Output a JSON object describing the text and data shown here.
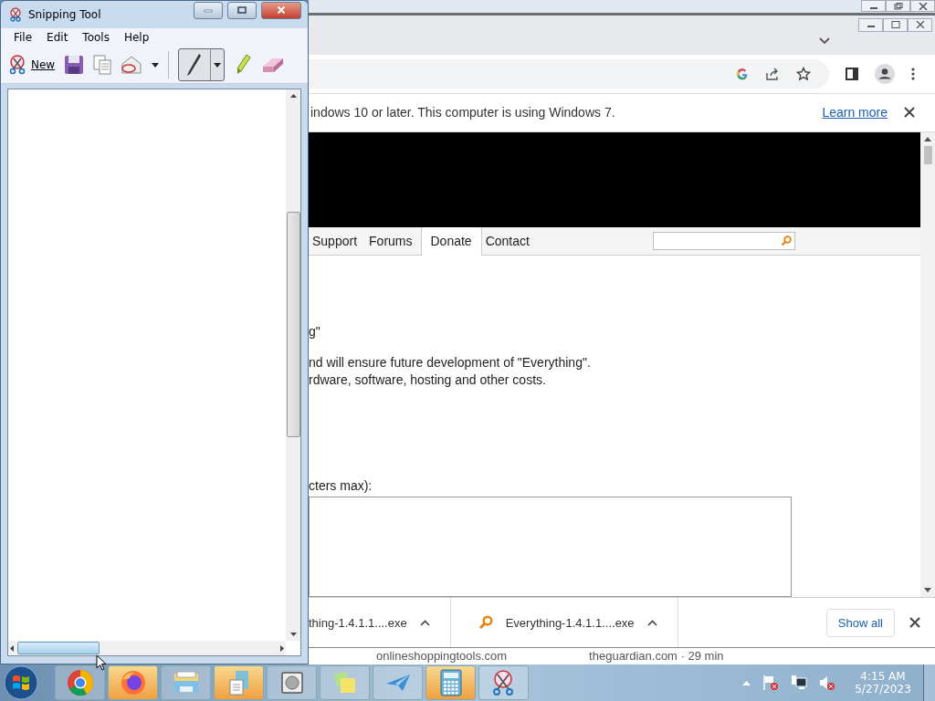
{
  "snipping_tool": {
    "title": "Snipping Tool",
    "menu": [
      "File",
      "Edit",
      "Tools",
      "Help"
    ],
    "new_label": "New",
    "pen_selected": true
  },
  "browser": {
    "infobar": {
      "message": "indows 10 or later. This computer is using Windows 7.",
      "link": "Learn more"
    },
    "nav_tabs": [
      {
        "label": "Support",
        "selected": false
      },
      {
        "label": "Forums",
        "selected": false
      },
      {
        "label": "Donate",
        "selected": true
      },
      {
        "label": "Contact",
        "selected": false
      }
    ],
    "heading_tail": "g\"",
    "body_lines": [
      "nd will ensure future development of \"Everything\".",
      "rdware, software, hosting and other costs."
    ],
    "field_label": "cters max):",
    "downloads": [
      {
        "filename": "thing-1.4.1.1....exe",
        "icon_shown": false
      },
      {
        "filename": "Everything-1.4.1.1....exe",
        "icon_shown": true
      }
    ],
    "show_all": "Show all",
    "history": [
      "onlineshoppingtools.com",
      "theguardian.com · 29 min"
    ]
  },
  "taskbar": {
    "apps": [
      {
        "kind": "chrome",
        "highlighted": false
      },
      {
        "kind": "firefox",
        "highlighted": true
      },
      {
        "kind": "explorer",
        "highlighted": false
      },
      {
        "kind": "document",
        "highlighted": true
      },
      {
        "kind": "disk",
        "highlighted": false
      },
      {
        "kind": "notes",
        "highlighted": false
      },
      {
        "kind": "plane",
        "highlighted": false
      },
      {
        "kind": "calculator",
        "highlighted": true
      },
      {
        "kind": "scissors",
        "highlighted": false
      }
    ],
    "time": "4:15 AM",
    "date": "5/27/2023"
  }
}
